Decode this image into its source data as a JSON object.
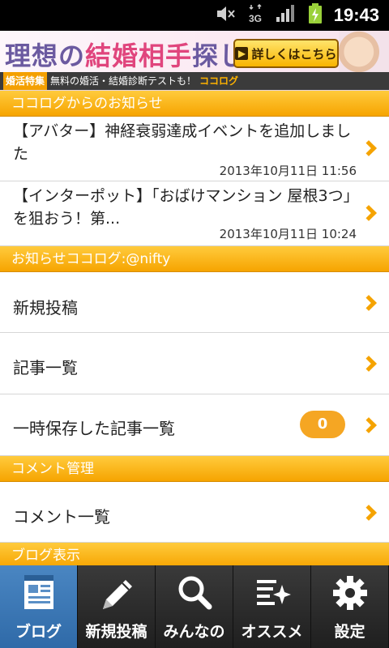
{
  "status_bar": {
    "time": "19:43",
    "icons": [
      "mute-icon",
      "3g-icon",
      "signal-icon",
      "battery-charging-icon"
    ],
    "network_label": "3G"
  },
  "ad": {
    "headline_a": "理想の",
    "headline_b": "結婚相手",
    "headline_c": "探し",
    "button_label": "詳しくはこちら",
    "sub_tag": "婚活特集",
    "sub_text": "無料の婚活・結婚診断テストも！",
    "logo": "ココログ"
  },
  "sections": {
    "news_header": "ココログからのお知らせ",
    "blog_header": "お知らせココログ:@nifty",
    "comment_header": "コメント管理",
    "display_header": "ブログ表示"
  },
  "news": [
    {
      "title": "【アバター】神経衰弱達成イベントを追加しました",
      "date": "2013年10月11日 11:56"
    },
    {
      "title": "【インターポット】「おばけマンション 屋根3つ」を狙おう！第...",
      "date": "2013年10月11日 10:24"
    }
  ],
  "blog_menu": {
    "new_post": "新規投稿",
    "post_list": "記事一覧",
    "drafts": "一時保存した記事一覧",
    "drafts_count": "0"
  },
  "comment_menu": {
    "comment_list": "コメント一覧"
  },
  "tabs": [
    {
      "label": "ブログ",
      "icon": "blog-document-icon",
      "active": true
    },
    {
      "label": "新規投稿",
      "icon": "pencil-icon",
      "active": false
    },
    {
      "label": "みんなの",
      "icon": "search-icon",
      "active": false
    },
    {
      "label": "オススメ",
      "icon": "sparkle-list-icon",
      "active": false
    },
    {
      "label": "設定",
      "icon": "gear-icon",
      "active": false
    }
  ],
  "colors": {
    "accent_orange": "#f6a400",
    "tab_active_blue": "#3a78b8",
    "tab_bg": "#2b2b2b"
  }
}
